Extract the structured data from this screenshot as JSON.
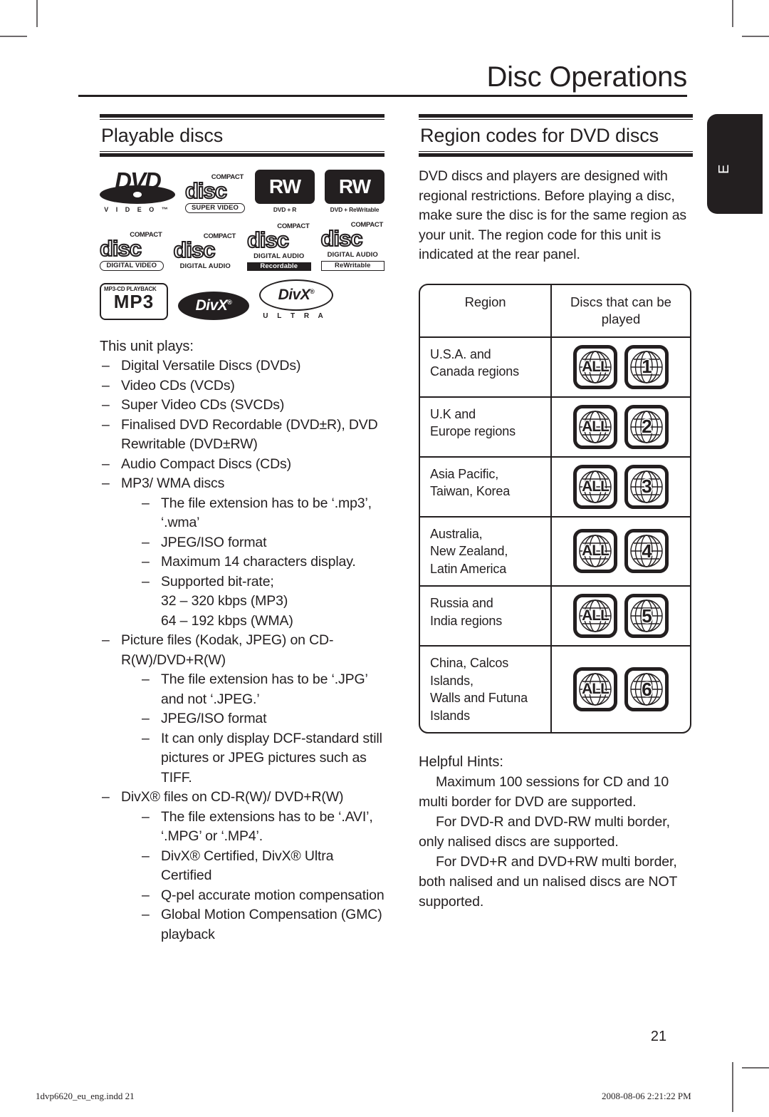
{
  "document": {
    "chapter_title": "Disc Operations",
    "page_number": "21",
    "language_tab": "E"
  },
  "footer": {
    "left": "1dvp6620_eu_eng.indd   21",
    "right": "2008-08-06   2:21:22 PM"
  },
  "left_column": {
    "heading": "Playable discs",
    "logos": [
      {
        "name": "dvd-video-logo",
        "word": "DVD",
        "sub": "V I D E O ™"
      },
      {
        "name": "compact-disc-super-video-logo",
        "top": "COMPACT",
        "word": "disc",
        "band": "SUPER  VIDEO"
      },
      {
        "name": "dvd-plus-r-logo",
        "plate": "RW",
        "cap": "DVD + R"
      },
      {
        "name": "dvd-plus-rewritable-logo",
        "plate": "RW",
        "cap": "DVD + ReWritable"
      },
      {
        "name": "compact-disc-digital-video-logo",
        "top": "COMPACT",
        "word": "disc",
        "band": "DIGITAL VIDEO"
      },
      {
        "name": "compact-disc-digital-audio-logo",
        "top": "COMPACT",
        "word": "disc",
        "band": "DIGITAL AUDIO"
      },
      {
        "name": "compact-disc-recordable-logo",
        "top": "COMPACT",
        "word": "disc",
        "band": "DIGITAL AUDIO",
        "band2": "Recordable"
      },
      {
        "name": "compact-disc-rewritable-logo",
        "top": "COMPACT",
        "word": "disc",
        "band": "DIGITAL AUDIO",
        "band2": "ReWritable"
      },
      {
        "name": "mp3-cd-playback-logo",
        "cap": "MP3-CD PLAYBACK",
        "word": "MP3"
      },
      {
        "name": "divx-logo",
        "word": "DivX",
        "reg": "®"
      },
      {
        "name": "divx-ultra-logo",
        "word": "DivX",
        "reg": "®",
        "ultra": "U L T R A"
      }
    ],
    "lead": "This unit plays:",
    "items": [
      {
        "text": "Digital Versatile Discs (DVDs)"
      },
      {
        "text": "Video CDs (VCDs)"
      },
      {
        "text": "Super Video CDs (SVCDs)"
      },
      {
        "text": "Finalised DVD Recordable (DVD±R), DVD Rewritable (DVD±RW)"
      },
      {
        "text": "Audio Compact Discs (CDs)"
      },
      {
        "text": "MP3/ WMA discs",
        "children": [
          {
            "text": "The file extension has to be ‘.mp3’, ‘.wma’"
          },
          {
            "text": "JPEG/ISO format"
          },
          {
            "text": "Maximum 14 characters display."
          },
          {
            "text": "Supported bit-rate;",
            "plain": [
              "32 – 320 kbps (MP3)",
              "64 – 192 kbps (WMA)"
            ]
          }
        ]
      },
      {
        "text": "Picture files (Kodak, JPEG) on CD-R(W)/DVD+R(W)",
        "children": [
          {
            "text": "The file extension has to be ‘.JPG’ and not ‘.JPEG.’"
          },
          {
            "text": "JPEG/ISO format"
          },
          {
            "text": "It can only display DCF-standard still pictures or JPEG pictures such as TIFF."
          }
        ]
      },
      {
        "text": "DivX® files on CD-R(W)/ DVD+R(W)",
        "children": [
          {
            "text": "The file extensions has to be ‘.AVI’, ‘.MPG’ or ‘.MP4’."
          },
          {
            "text": "DivX® Certified, DivX® Ultra Certified"
          },
          {
            "text": "Q-pel accurate motion compensation"
          },
          {
            "text": "Global Motion Compensation (GMC) playback"
          }
        ]
      }
    ],
    "dash": "–"
  },
  "right_column": {
    "heading": "Region codes for DVD discs",
    "intro": "DVD discs and players are designed with regional restrictions. Before playing a disc, make sure the disc is for the same region as your unit. The region code for this unit is indicated at the rear panel.",
    "table": {
      "headers": [
        "Region",
        "Discs that can be played"
      ],
      "rows": [
        {
          "region": [
            "U.S.A. and",
            "Canada regions"
          ],
          "badges": [
            "ALL",
            "1"
          ]
        },
        {
          "region": [
            "U.K and",
            "Europe regions"
          ],
          "badges": [
            "ALL",
            "2"
          ]
        },
        {
          "region": [
            "Asia Pacific,",
            "Taiwan, Korea"
          ],
          "badges": [
            "ALL",
            "3"
          ]
        },
        {
          "region": [
            "Australia,",
            "New Zealand,",
            "Latin America"
          ],
          "badges": [
            "ALL",
            "4"
          ]
        },
        {
          "region": [
            "Russia and",
            "India regions"
          ],
          "badges": [
            "ALL",
            "5"
          ]
        },
        {
          "region": [
            "China, Calcos",
            "Islands,",
            "Walls and Futuna",
            "Islands"
          ],
          "badges": [
            "ALL",
            "6"
          ]
        }
      ]
    },
    "hints": {
      "title": "Helpful Hints:",
      "paragraphs": [
        "Maximum 100 sessions for CD and 10 multi border for DVD are supported.",
        "For DVD-R and DVD-RW multi border, only  nalised discs are supported.",
        "For DVD+R and DVD+RW multi border, both  nalised and un nalised discs are NOT supported."
      ]
    }
  },
  "colors": {
    "ink": "#231f20",
    "crop_mark": "#6d6a6b",
    "paper": "#ffffff"
  }
}
